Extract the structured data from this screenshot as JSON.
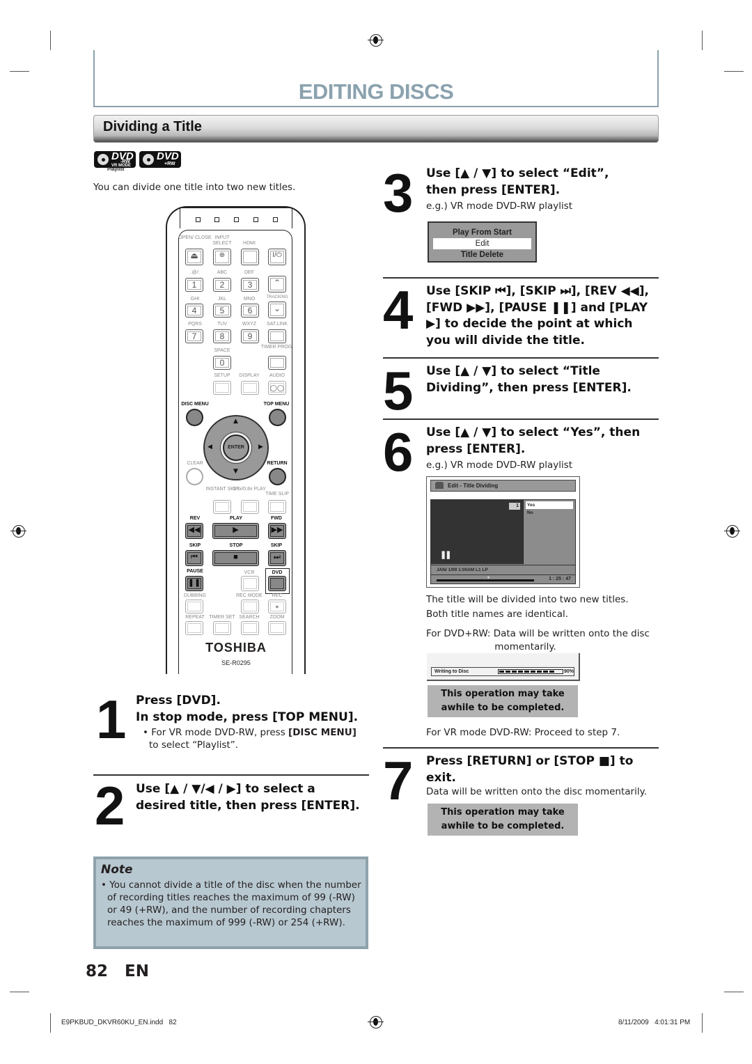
{
  "header": {
    "title": "EDITING DISCS",
    "section": "Dividing a Title"
  },
  "logos": [
    {
      "main": "DVD",
      "sub1": "-RW",
      "sub2": "VR MODE",
      "caption": "Playlist"
    },
    {
      "main": "DVD",
      "sub1": "+RW"
    }
  ],
  "intro": "You can divide one title into two new titles.",
  "remote": {
    "brand": "TOSHIBA",
    "model": "SE-R0295",
    "labels": {
      "open_close": "OPEN/ CLOSE",
      "input_select": "INPUT SELECT",
      "hdmi": "HDMI",
      "k1": ".@/:",
      "k2": "ABC",
      "k3": "DEF",
      "k4": "GHI",
      "k5": "JKL",
      "k6": "MNO",
      "k7": "PQRS",
      "k8": "TUV",
      "k9": "WXYZ",
      "sat_link": "SAT.LINK",
      "tracking": "TRACKING",
      "space": "SPACE",
      "timer_prog": "TIMER PROG.",
      "setup": "SETUP",
      "display": "DISPLAY",
      "audio": "AUDIO",
      "disc_menu": "DISC MENU",
      "top_menu": "TOP MENU",
      "enter": "ENTER",
      "clear": "CLEAR",
      "return": "RETURN",
      "instant_skip": "INSTANT SKIP",
      "speed_play": "1.3x/0.8x PLAY",
      "time_slip": "TIME SLIP",
      "rev": "REV",
      "play": "PLAY",
      "fwd": "FWD",
      "skip_back": "SKIP",
      "stop": "STOP",
      "skip_fwd": "SKIP",
      "pause": "PAUSE",
      "vcr": "VCR",
      "dvd": "DVD",
      "dubbing": "DUBBING",
      "rec_mode": "REC MODE",
      "rec": "REC",
      "repeat": "REPEAT",
      "timer_set": "TIMER SET",
      "search": "SEARCH",
      "zoom": "ZOOM"
    },
    "digits": [
      "1",
      "2",
      "3",
      "4",
      "5",
      "6",
      "7",
      "8",
      "9",
      "0"
    ],
    "power": "I/⏻"
  },
  "steps": [
    {
      "num": "1",
      "heading": "Press [DVD].\nIn stop mode, press [TOP MENU].",
      "bullet_pre": "For VR mode DVD-RW, press ",
      "bullet_bold": "[DISC MENU]",
      "bullet_post": " to select “Playlist”."
    },
    {
      "num": "2",
      "heading": "Use [▲ / ▼/◀ / ▶] to select a desired title, then press [ENTER]."
    },
    {
      "num": "3",
      "heading": "Use [▲ / ▼] to select “Edit”, then press [ENTER].",
      "sub": "e.g.) VR mode DVD-RW playlist"
    },
    {
      "num": "4",
      "heading": "Use [SKIP ⏮], [SKIP ⏭], [REV ◀◀], [FWD ▶▶], [PAUSE ❚❚] and [PLAY ▶] to decide the point at which you will divide the title."
    },
    {
      "num": "5",
      "heading": "Use [▲ / ▼] to select “Title Dividing”, then press [ENTER]."
    },
    {
      "num": "6",
      "heading": "Use [▲ / ▼] to select “Yes”, then press [ENTER].",
      "sub": "e.g.) VR mode DVD-RW playlist"
    },
    {
      "num": "7",
      "heading": "Press [RETURN] or [STOP ■] to exit.",
      "sub": "Data will be written onto the disc momentarily."
    }
  ],
  "osd_menu": {
    "items": [
      "Play From Start",
      "Edit",
      "Title Delete"
    ],
    "selected": "Edit"
  },
  "osd_divide": {
    "title": "Edit - Title Dividing",
    "chapter": "1",
    "options": [
      "Yes",
      "No"
    ],
    "selected": "Yes",
    "pause_symbol": "❚❚",
    "info": "JAN/ 1/09 1:00AM L1   LP",
    "time": "1 : 25 : 47"
  },
  "after_step6": {
    "line1": "The title will be divided into two new titles.",
    "line2": "Both title names are identical.",
    "plus_rw_note": "For DVD+RW: Data will be written onto the disc",
    "plus_rw_note2": "momentarily.",
    "writing_label": "Writing to Disc",
    "writing_progress_percent": 90,
    "writing_pct_text": "90%",
    "warning": "This operation may take awhile to be completed.",
    "vr_note": "For VR mode DVD-RW: Proceed to step 7."
  },
  "step7_warning": "This operation may take awhile to be completed.",
  "note": {
    "title": "Note",
    "text": "• You cannot divide a title of the disc when the number of recording titles reaches the maximum of 99 (-RW) or 49 (+RW), and the number of recording chapters reaches the maximum of 999 (-RW) or 254 (+RW)."
  },
  "page": {
    "number": "82",
    "lang": "EN"
  },
  "footer": {
    "file": "E9PKBUD_DKVR60KU_EN.indd   82",
    "timestamp": "8/11/2009   4:01:31 PM"
  }
}
